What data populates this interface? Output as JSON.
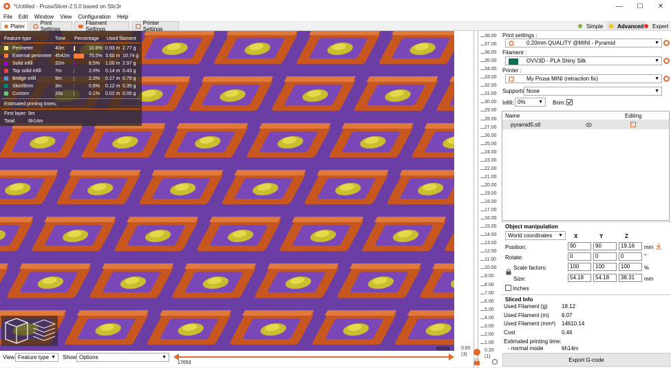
{
  "window": {
    "title": "*Untitled - PrusaSlicer-2.5.0 based on Slic3r",
    "minimize": "—",
    "maximize": "☐",
    "close": "✕"
  },
  "menu": [
    "File",
    "Edit",
    "Window",
    "View",
    "Configuration",
    "Help"
  ],
  "tabs": [
    {
      "label": "Plater",
      "icon": "plater-icon"
    },
    {
      "label": "Print Settings",
      "icon": "print-settings-icon"
    },
    {
      "label": "Filament Settings",
      "icon": "filament-settings-icon"
    },
    {
      "label": "Printer Settings",
      "icon": "printer-settings-icon"
    }
  ],
  "modes": [
    {
      "label": "Simple",
      "color": "#7cb342"
    },
    {
      "label": "Advanced",
      "color": "#f5c400"
    },
    {
      "label": "Expert",
      "color": "#e0301e"
    }
  ],
  "legend": {
    "headers": [
      "Feature type",
      "Time",
      "Percentage",
      "Used filament"
    ],
    "rows": [
      {
        "name": "Perimeter",
        "time": "40m",
        "pct": "10.8%",
        "len": "0.93 m",
        "weight": "2.77 g",
        "color": "#ffe680",
        "frac": 0.108
      },
      {
        "name": "External perimeter",
        "time": "4h42m",
        "pct": "75.5%",
        "len": "3.60 m",
        "weight": "10.74 g",
        "color": "#ff7d38",
        "frac": 0.755
      },
      {
        "name": "Solid infill",
        "time": "32m",
        "pct": "8.5%",
        "len": "1.00 m",
        "weight": "2.97 g",
        "color": "#9900cc",
        "frac": 0.085
      },
      {
        "name": "Top solid infill",
        "time": "7m",
        "pct": "2.0%",
        "len": "0.14 m",
        "weight": "0.43 g",
        "color": "#f04040",
        "frac": 0.02
      },
      {
        "name": "Bridge infill",
        "time": "9m",
        "pct": "2.3%",
        "len": "0.27 m",
        "weight": "0.79 g",
        "color": "#5d8fd8",
        "frac": 0.023
      },
      {
        "name": "Skirt/Brim",
        "time": "3m",
        "pct": "0.8%",
        "len": "0.12 m",
        "weight": "0.35 g",
        "color": "#00876e",
        "frac": 0.008
      },
      {
        "name": "Custom",
        "time": "20s",
        "pct": "0.1%",
        "len": "0.02 m",
        "weight": "0.05 g",
        "color": "#5ec97a",
        "frac": 0.001
      }
    ],
    "est_title": "Estimated printing times:",
    "first_layer_label": "First layer:",
    "first_layer_value": "9m",
    "total_label": "Total:",
    "total_value": "6h14m"
  },
  "ruler": {
    "labels": [
      "38.00",
      "37.00",
      "36.00",
      "35.00",
      "34.00",
      "33.00",
      "32.00",
      "31.00",
      "30.00",
      "29.00",
      "28.00",
      "27.00",
      "26.00",
      "25.00",
      "24.00",
      "23.00",
      "22.00",
      "21.00",
      "20.00",
      "19.00",
      "18.00",
      "17.00",
      "16.00",
      "15.00",
      "14.00",
      "13.00",
      "12.00",
      "11.00",
      "10.00",
      "9.00",
      "8.00",
      "7.00",
      "6.00",
      "5.00",
      "4.00",
      "3.00",
      "2.00",
      "1.00"
    ],
    "low_value": "0.60",
    "low_index": "(3)",
    "low_value2": "0.20",
    "low_index2": "(1)"
  },
  "bottom": {
    "view_label": "View",
    "view_value": "Feature type",
    "show_label": "Show",
    "show_value": "Options",
    "h_max": "45239",
    "h_min": "17053"
  },
  "panel": {
    "print_settings_label": "Print settings :",
    "print_settings_value": "0.20mm QUALITY @MINI - Pyramid",
    "filament_label": "Filament :",
    "filament_value": "OVV3D - PLA Shiny Silk",
    "filament_color": "#0b6f55",
    "printer_label": "Printer :",
    "printer_value": "My Prusa MINI (retraction fix)",
    "supports_label": "Supports:",
    "supports_value": "None",
    "infill_label": "Infill:",
    "infill_value": "0%",
    "brim_label": "Brim:",
    "list_name_header": "Name",
    "list_editing_header": "Editing",
    "object_name": "pyramid5.stl",
    "om_title": "Object manipulation",
    "coord_value": "World coordinates",
    "axis": [
      "X",
      "Y",
      "Z"
    ],
    "position_label": "Position:",
    "position": [
      "90",
      "90",
      "19.16"
    ],
    "position_unit": "mm",
    "rotate_label": "Rotate:",
    "rotate": [
      "0",
      "0",
      "0"
    ],
    "rotate_unit": "°",
    "scale_label": "Scale factors:",
    "scale": [
      "100",
      "100",
      "100"
    ],
    "scale_unit": "%",
    "size_label": "Size:",
    "size": [
      "54.18",
      "54.18",
      "38.31"
    ],
    "size_unit": "mm",
    "inches_label": "Inches",
    "sliced_title": "Sliced Info",
    "info": [
      {
        "k": "Used Filament (g)",
        "v": "18.12"
      },
      {
        "k": "Used Filament (m)",
        "v": "6.07"
      },
      {
        "k": "Used Filament (mm³)",
        "v": "14610.14"
      },
      {
        "k": "Cost",
        "v": "0.46"
      },
      {
        "k": "Estimated printing time:",
        "v": ""
      },
      {
        "k": "- normal mode",
        "v": "6h14m"
      }
    ],
    "export_label": "Export G-code"
  }
}
